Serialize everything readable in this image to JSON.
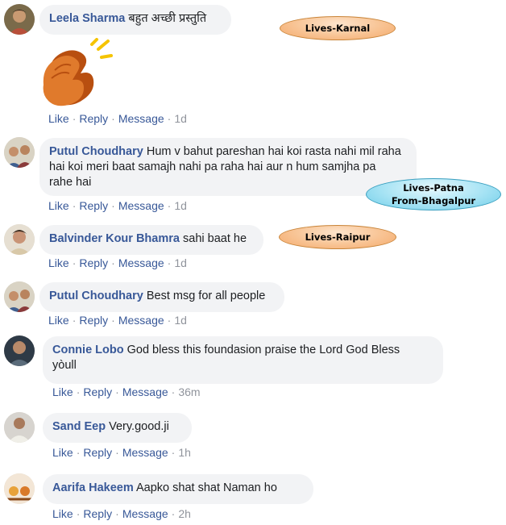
{
  "comments": [
    {
      "author": "Leela Sharma",
      "text": "बहुत अच्छी प्रस्तुति",
      "actions": {
        "like": "Like",
        "reply": "Reply",
        "message": "Message",
        "time": "1d"
      }
    },
    {
      "author": "Putul Choudhary",
      "text_lines": [
        "Hum v bahut pareshan hai koi rasta nahi mil raha",
        "hai koi meri baat samajh nahi pa raha hai aur n hum samjha pa",
        "rahe hai"
      ],
      "actions": {
        "like": "Like",
        "reply": "Reply",
        "message": "Message",
        "time": "1d"
      }
    },
    {
      "author": "Balvinder Kour Bhamra",
      "text": "sahi baat he",
      "actions": {
        "like": "Like",
        "reply": "Reply",
        "message": "Message",
        "time": "1d"
      }
    },
    {
      "author": "Putul Choudhary",
      "text": "Best msg for all people",
      "actions": {
        "like": "Like",
        "reply": "Reply",
        "message": "Message",
        "time": "1d"
      }
    },
    {
      "author": "Connie Lobo",
      "text_lines": [
        "God bless this foundasion praise the Lord God Bless",
        "yòull"
      ],
      "actions": {
        "like": "Like",
        "reply": "Reply",
        "message": "Message",
        "time": "36m"
      }
    },
    {
      "author": "Sand Eep",
      "text": "Very.good.ji",
      "actions": {
        "like": "Like",
        "reply": "Reply",
        "message": "Message",
        "time": "1h"
      }
    },
    {
      "author": "Aarifa Hakeem",
      "text": "Aapko shat shat Naman ho",
      "actions": {
        "like": "Like",
        "reply": "Reply",
        "message": "Message",
        "time": "2h"
      }
    }
  ],
  "annotations": {
    "karnal": "Lives-Karnal",
    "patna_line1": "Lives-Patna",
    "patna_line2": "From-Bhagalpur",
    "raipur": "Lives-Raipur"
  },
  "colors": {
    "author": "#385898",
    "bubble": "#f2f3f5",
    "meta": "#90949c",
    "tag_orange": "#f8c393",
    "tag_blue": "#a6e3f4"
  },
  "icons": [
    "clapping-hands-emoji"
  ]
}
